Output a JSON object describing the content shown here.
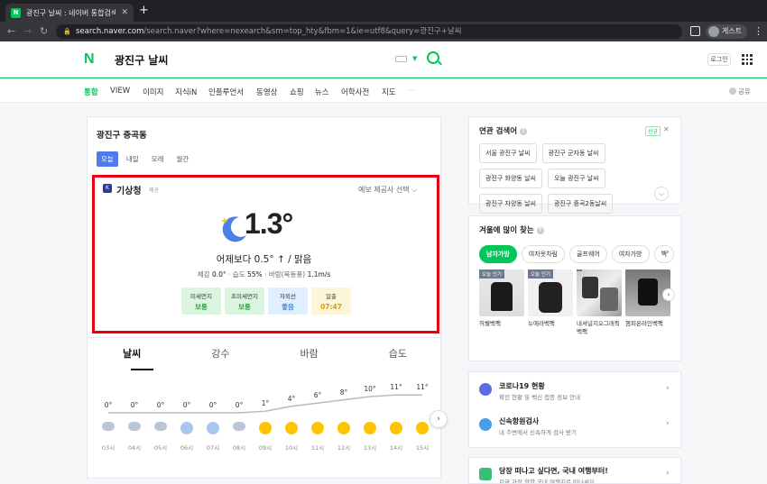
{
  "browser": {
    "tab_title": "광진구 날씨 : 네이버 통합검색",
    "tab_favicon": "N",
    "url_host": "search.naver.com",
    "url_path": "/search.naver?where=nexearch&sm=top_hty&fbm=1&ie=utf8&query=광진구+날씨",
    "guest_label": "게스트"
  },
  "header": {
    "logo": "N",
    "query": "광진구 날씨",
    "login_label": "로그인"
  },
  "nav_tabs": [
    {
      "label": "통합"
    },
    {
      "label": "VIEW"
    },
    {
      "label": "이미지"
    },
    {
      "label": "지식iN"
    },
    {
      "label": "인플루언서"
    },
    {
      "label": "동영상"
    },
    {
      "label": "쇼핑"
    },
    {
      "label": "뉴스"
    },
    {
      "label": "어학사전"
    },
    {
      "label": "지도"
    },
    {
      "label": "···"
    }
  ],
  "share_label": "공유",
  "weather": {
    "location": "광진구 중곡동",
    "day_tabs": [
      "오늘",
      "내일",
      "모레",
      "월간"
    ],
    "provider": "기상청",
    "provider_sub": "제공",
    "provider_select": "예보 제공사 선택 ⌵",
    "temperature": "1.3°",
    "compare": "어제보다 0.5° ↑  /  맑음",
    "feels_label": "체감",
    "feels_value": "0.0°",
    "humidity_label": "습도",
    "humidity_value": "55%",
    "wind_label": "바람(북동풍)",
    "wind_value": "1.1m/s",
    "badges": [
      {
        "label": "미세먼지",
        "value": "보통",
        "color": "green"
      },
      {
        "label": "초미세먼지",
        "value": "보통",
        "color": "green"
      },
      {
        "label": "자외선",
        "value": "좋음",
        "color": "blue"
      },
      {
        "label": "일출",
        "value": "07:47",
        "color": "yellow"
      }
    ]
  },
  "forecast": {
    "tabs": [
      "날씨",
      "강수",
      "바람",
      "습도"
    ],
    "hours": [
      {
        "temp": "0°",
        "time": "03시",
        "icon": "cloud-moon-icon"
      },
      {
        "temp": "0°",
        "time": "04시",
        "icon": "cloud-moon-icon"
      },
      {
        "temp": "0°",
        "time": "05시",
        "icon": "cloud-moon-icon"
      },
      {
        "temp": "0°",
        "time": "06시",
        "icon": "moon-icon"
      },
      {
        "temp": "0°",
        "time": "07시",
        "icon": "moon-icon"
      },
      {
        "temp": "0°",
        "time": "08시",
        "icon": "cloud-sun-icon"
      },
      {
        "temp": "1°",
        "time": "09시",
        "icon": "sun-icon"
      },
      {
        "temp": "4°",
        "time": "10시",
        "icon": "sun-icon"
      },
      {
        "temp": "6°",
        "time": "11시",
        "icon": "sun-icon"
      },
      {
        "temp": "8°",
        "time": "12시",
        "icon": "sun-icon"
      },
      {
        "temp": "10°",
        "time": "13시",
        "icon": "sun-icon"
      },
      {
        "temp": "11°",
        "time": "14시",
        "icon": "sun-icon"
      },
      {
        "temp": "11°",
        "time": "15시",
        "icon": "sun-icon"
      }
    ]
  },
  "related": {
    "title": "연관 검색어",
    "new_label": "신규",
    "items": [
      "서울 광진구 날씨",
      "광진구 군자동 날씨",
      "광진구 화양동 날씨",
      "오늘 광진구 날씨",
      "광진구 자양동 날씨",
      "광진구 중곡2동날씨"
    ]
  },
  "winter": {
    "title": "겨울에 많이 찾는",
    "pills": [
      "남자가방",
      "여자옷차림",
      "골프웨어",
      "여자가방",
      "백"
    ],
    "products": [
      {
        "tag": "오늘 인기",
        "name": "허쉘백팩"
      },
      {
        "tag": "오늘 인기",
        "name": "뉴에라백팩"
      },
      {
        "tag": "",
        "name": "내셔널지오그래픽백팩"
      },
      {
        "tag": "",
        "name": "챔피온라인백팩"
      }
    ]
  },
  "links": [
    {
      "title": "코로나19 현황",
      "sub": "확진 현황 및 백신 접종 정보 안내"
    },
    {
      "title": "신속항원검사",
      "sub": "내 주변에서 신속하게 검사 받기"
    }
  ],
  "travel": {
    "title": "당장 떠나고 싶다면, 국내 여행부터!",
    "sub": "지금 가장 핫한 국내 여행지로 떠나세요"
  }
}
